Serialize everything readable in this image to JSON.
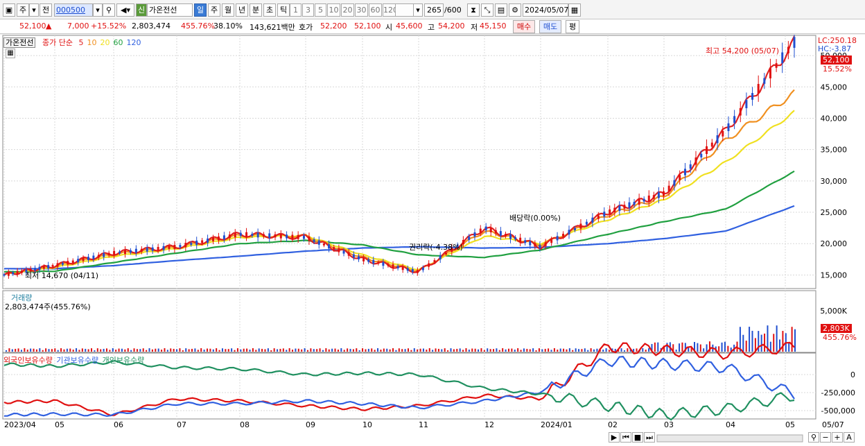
{
  "toolbar": {
    "market_type": "주",
    "prev_label": "전",
    "stock_code": "000500",
    "new_badge": "신",
    "stock_name": "가온전선",
    "periods": [
      "일",
      "주",
      "월",
      "년",
      "분",
      "초",
      "틱"
    ],
    "active_period": "일",
    "intervals": [
      "1",
      "3",
      "5",
      "10",
      "20",
      "30",
      "60",
      "120"
    ],
    "count_value": "265",
    "count_max": "/600",
    "date": "2024/05/07"
  },
  "quote": {
    "price": "52,100",
    "change": "7,000",
    "change_pct": "+15.52%",
    "volume": "2,803,474",
    "volume_ratio": "455.76%",
    "turnover_rate": "38.10%",
    "amount": "143,621백만",
    "hoga_label": "호가",
    "hoga_ask": "52,200",
    "hoga_bid": "52,100",
    "open_label": "시",
    "open": "45,600",
    "high_label": "고",
    "high": "54,200",
    "low_label": "저",
    "low": "45,150",
    "buy_label": "매수",
    "sell_label": "매도",
    "eval_label": "평"
  },
  "price_panel": {
    "stock_tab": "가온전선",
    "legend_prefix": "종가 단순",
    "ma_periods": [
      "5",
      "10",
      "20",
      "60",
      "120"
    ],
    "ma_colors": [
      "#e02020",
      "#f09020",
      "#f0e020",
      "#20a040",
      "#3060e0"
    ],
    "lc_label": "LC:250.18",
    "hc_label": "HC:-3.87",
    "current_price_label": "52,100",
    "current_pct_label": "15.52%",
    "high_annotation": "최고 54,200 (05/07)",
    "low_annotation": "최저 14,670 (04/11)",
    "event_rights": "권리락(-4.38%)",
    "event_dividend": "배당락(0.00%)",
    "y_ticks": [
      "50,000",
      "45,000",
      "40,000",
      "35,000",
      "30,000",
      "25,000",
      "20,000",
      "15,000"
    ]
  },
  "volume_panel": {
    "title": "거래량",
    "summary": "2,803,474주(455.76%)",
    "y_tick": "5,000K",
    "current_label": "2,803K",
    "current_pct": "455.76%"
  },
  "holding_panel": {
    "series": [
      "외국인보유수량",
      "기관보유수량",
      "개인보유수량"
    ],
    "colors": [
      "#e01010",
      "#3060e0",
      "#209060"
    ],
    "y_ticks": [
      "0",
      "-250,000",
      "-500,000"
    ]
  },
  "x_axis": {
    "labels": [
      "2023/04",
      "05",
      "06",
      "07",
      "08",
      "09",
      "10",
      "11",
      "12",
      "2024/01",
      "02",
      "03",
      "04",
      "05"
    ],
    "end_label": "05/07"
  },
  "chart_data": {
    "type": "line",
    "x": [
      "2023/04",
      "05",
      "06",
      "07",
      "08",
      "09",
      "10",
      "11",
      "12",
      "2024/01",
      "02",
      "03",
      "04",
      "05/07"
    ],
    "series": [
      {
        "name": "5",
        "values": [
          15000,
          16500,
          18500,
          19500,
          21500,
          21000,
          17500,
          15500,
          22500,
          19500,
          25000,
          28000,
          38000,
          52100
        ]
      },
      {
        "name": "10",
        "values": [
          15000,
          16400,
          18300,
          19400,
          21300,
          21200,
          17800,
          15600,
          22000,
          19800,
          24500,
          27500,
          36500,
          44000
        ]
      },
      {
        "name": "20",
        "values": [
          15100,
          16200,
          18000,
          19200,
          21000,
          21300,
          18200,
          15800,
          21200,
          20000,
          23800,
          27000,
          33000,
          41000
        ]
      },
      {
        "name": "60",
        "values": [
          15500,
          15600,
          17000,
          18500,
          20000,
          20500,
          19800,
          18200,
          17800,
          19000,
          21500,
          23500,
          25500,
          31500
        ]
      },
      {
        "name": "120",
        "values": [
          16000,
          16000,
          16500,
          17300,
          18000,
          18800,
          19300,
          19500,
          19300,
          19400,
          20000,
          20800,
          22000,
          26000
        ]
      }
    ],
    "ylim": [
      13500,
      52000
    ]
  }
}
